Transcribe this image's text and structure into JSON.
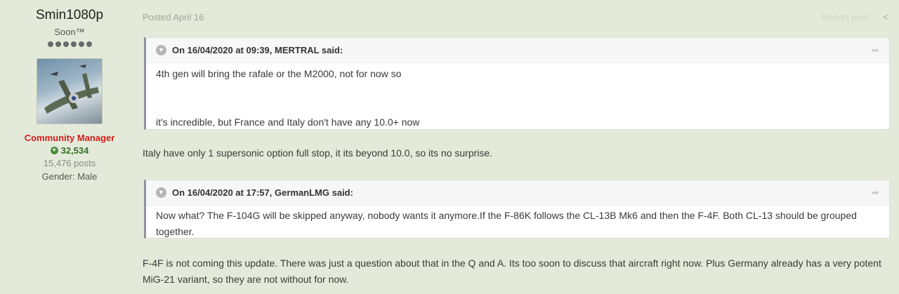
{
  "author": {
    "name": "Smin1080p",
    "title": "Soon™",
    "group": "Community Manager",
    "reputation": "32,534",
    "posts": "15,476 posts",
    "gender": "Gender: Male"
  },
  "post": {
    "posted": "Posted April 16",
    "report": "Report post",
    "quotes": [
      {
        "header": "On 16/04/2020 at 09:39, MERTRAL said:",
        "lines": [
          "4th gen will bring the rafale or the M2000, not for now so",
          "it's incredible, but France and Italy don't have any 10.0+ now"
        ]
      },
      {
        "header": "On 16/04/2020 at 17:57, GermanLMG said:",
        "lines": [
          "Now what? The F-104G will be skipped anyway, nobody wants it anymore.If the F-86K follows the CL-13B Mk6 and then the F-4F. Both CL-13 should be grouped together."
        ]
      }
    ],
    "replies": [
      "Italy have only 1 supersonic option full stop, it its beyond 10.0, so its no surprise.",
      "F-4F is not coming this update. There was just a question about that in the Q and A. Its too soon to discuss that aircraft right now. Plus Germany already has a very potent MiG-21 variant, so they are not without for now."
    ]
  }
}
